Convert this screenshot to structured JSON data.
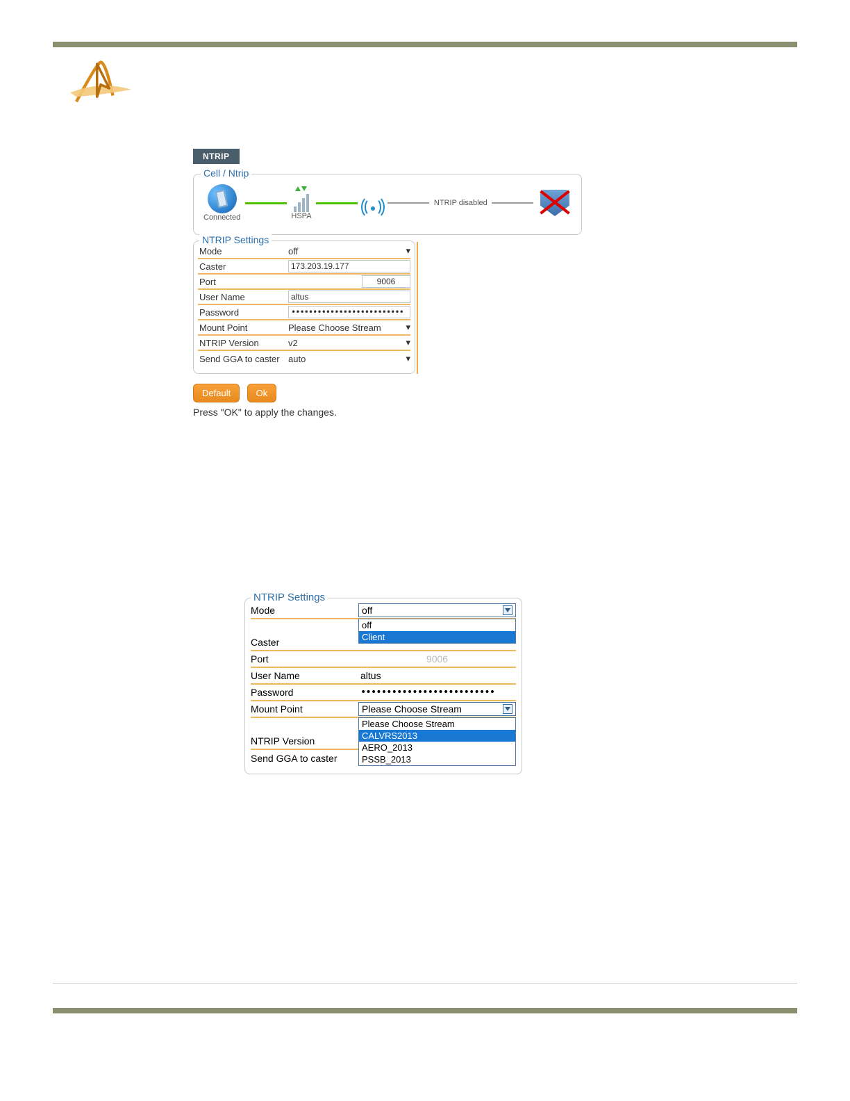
{
  "tab_label": "NTRIP",
  "cell_ntrip": {
    "legend": "Cell / Ntrip",
    "phone_status": "Connected",
    "signal_label": "HSPA",
    "ntrip_status": "NTRIP disabled"
  },
  "settings1": {
    "legend": "NTRIP Settings",
    "rows": {
      "mode_lbl": "Mode",
      "mode_val": "off",
      "caster_lbl": "Caster",
      "caster_val": "173.203.19.177",
      "port_lbl": "Port",
      "port_val": "9006",
      "user_lbl": "User Name",
      "user_val": "altus",
      "pass_lbl": "Password",
      "pass_val": "••••••••••••••••••••••••••",
      "mount_lbl": "Mount Point",
      "mount_val": "Please Choose Stream",
      "ver_lbl": "NTRIP Version",
      "ver_val": "v2",
      "gga_lbl": "Send GGA to caster",
      "gga_val": "auto"
    }
  },
  "buttons": {
    "default": "Default",
    "ok": "Ok"
  },
  "helper": "Press \"OK\" to apply the changes.",
  "settings2": {
    "legend": "NTRIP Settings",
    "mode_lbl": "Mode",
    "mode_val": "off",
    "mode_opts": [
      "off",
      "Client"
    ],
    "caster_lbl": "Caster",
    "port_lbl": "Port",
    "port_ghost": "9006",
    "user_lbl": "User Name",
    "user_val": "altus",
    "pass_lbl": "Password",
    "pass_val": "••••••••••••••••••••••••••",
    "mount_lbl": "Mount Point",
    "mount_val": "Please Choose Stream",
    "mount_opts": [
      "Please Choose Stream",
      "CALVRS2013",
      "AERO_2013",
      "PSSB_2013"
    ],
    "ver_lbl": "NTRIP Version",
    "gga_lbl": "Send GGA to caster"
  }
}
